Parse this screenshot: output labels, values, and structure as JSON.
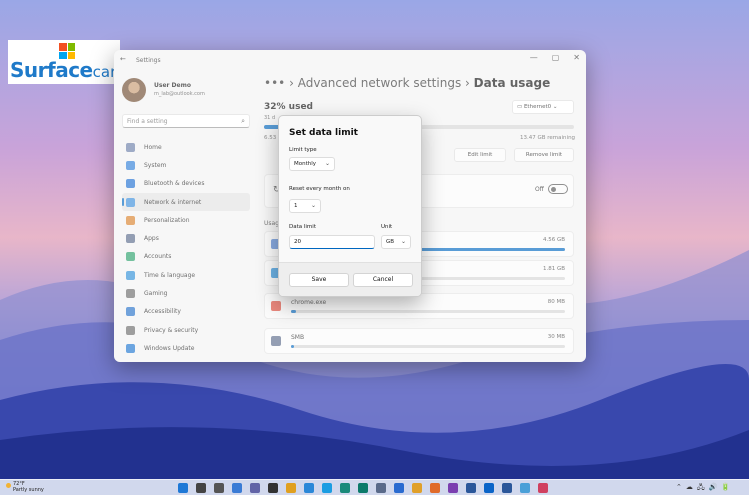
{
  "logo": {
    "brand": "Surface",
    "suffix": "care"
  },
  "window": {
    "title": "Settings",
    "back_glyph": "←",
    "controls": [
      "—",
      "▢",
      "✕"
    ]
  },
  "user": {
    "name": "User Demo",
    "email": "m_lab@outlook.com"
  },
  "sidebar": {
    "search_placeholder": "Find a setting",
    "items": [
      {
        "label": "Home",
        "icon": "home-icon",
        "color": "#6b7ea8"
      },
      {
        "label": "System",
        "icon": "system-icon",
        "color": "#2f7ed8"
      },
      {
        "label": "Bluetooth & devices",
        "icon": "bluetooth-icon",
        "color": "#1f6fd1"
      },
      {
        "label": "Network & internet",
        "icon": "network-icon",
        "color": "#3b8edb",
        "active": true
      },
      {
        "label": "Personalization",
        "icon": "brush-icon",
        "color": "#d9822b"
      },
      {
        "label": "Apps",
        "icon": "apps-icon",
        "color": "#5a6a8a"
      },
      {
        "label": "Accounts",
        "icon": "accounts-icon",
        "color": "#2aa06b"
      },
      {
        "label": "Time & language",
        "icon": "globe-icon",
        "color": "#2f8fd8"
      },
      {
        "label": "Gaming",
        "icon": "gaming-icon",
        "color": "#6b6b6b"
      },
      {
        "label": "Accessibility",
        "icon": "accessibility-icon",
        "color": "#2670c8"
      },
      {
        "label": "Privacy & security",
        "icon": "shield-icon",
        "color": "#6b6b6b"
      },
      {
        "label": "Windows Update",
        "icon": "update-icon",
        "color": "#1e76d0"
      }
    ]
  },
  "content": {
    "breadcrumb_more": "•••",
    "breadcrumb_parent": "Advanced network settings",
    "breadcrumb_sep": "›",
    "breadcrumb_current": "Data usage",
    "used_label": "32% used",
    "used_fraction": 0.32,
    "adapter": "Ethernet0",
    "small_top": "31 d",
    "small_left": "6.53",
    "remaining": "13.47 GB remaining",
    "edit_limit": "Edit limit",
    "remove_limit": "Remove limit",
    "throttle_sub": "ge",
    "toggle_state": "Off",
    "usage_label": "Usag",
    "apps": [
      {
        "name": "",
        "value": "4.56 GB",
        "fraction": 1.0,
        "icon_color": "#4a7fd1"
      },
      {
        "name": "",
        "value": "1.81 GB",
        "fraction": 0.4,
        "icon_color": "#1f8ad9"
      },
      {
        "name": "chrome.exe",
        "value": "80 MB",
        "fraction": 0.02,
        "icon_color": "#e04a3a"
      },
      {
        "name": "SMB",
        "value": "30 MB",
        "fraction": 0.01,
        "icon_color": "#5b6b8b"
      }
    ]
  },
  "dialog": {
    "title": "Set data limit",
    "limit_type_label": "Limit type",
    "limit_type_value": "Monthly",
    "reset_label": "Reset every month on",
    "reset_value": "1",
    "data_limit_label": "Data limit",
    "data_limit_value": "20",
    "unit_label": "Unit",
    "unit_value": "GB",
    "save": "Save",
    "cancel": "Cancel",
    "chevron": "⌄"
  },
  "taskbar": {
    "temperature": "72°F",
    "weather": "Partly sunny",
    "icons": [
      {
        "name": "windows-start-icon",
        "color": "#1e78d6"
      },
      {
        "name": "search-icon",
        "color": "#444444"
      },
      {
        "name": "task-view-icon",
        "color": "#555555"
      },
      {
        "name": "widgets-icon",
        "color": "#3a7bd5"
      },
      {
        "name": "teams-icon",
        "color": "#6264a7"
      },
      {
        "name": "terminal-icon",
        "color": "#333333"
      },
      {
        "name": "paint-icon",
        "color": "#e0a020"
      },
      {
        "name": "photos-icon",
        "color": "#2b88d8"
      },
      {
        "name": "edge-icon",
        "color": "#1b9de2"
      },
      {
        "name": "edge-beta-icon",
        "color": "#1a8a7a"
      },
      {
        "name": "edge-dev-icon",
        "color": "#0b7a6a"
      },
      {
        "name": "settings-icon",
        "color": "#5a6a8a"
      },
      {
        "name": "store-icon",
        "color": "#2a6bd0"
      },
      {
        "name": "chrome-icon",
        "color": "#e0a02a"
      },
      {
        "name": "firefox-icon",
        "color": "#e06b2a"
      },
      {
        "name": "onenote-icon",
        "color": "#7b3fb0"
      },
      {
        "name": "word-icon",
        "color": "#2b579a"
      },
      {
        "name": "outlook-icon",
        "color": "#0a64c8"
      },
      {
        "name": "word-2-icon",
        "color": "#2b579a"
      },
      {
        "name": "notepad-icon",
        "color": "#4aa0d8"
      },
      {
        "name": "snipping-icon",
        "color": "#d04060"
      }
    ],
    "tray": [
      "⌃",
      "☁",
      "🖧",
      "🔊",
      "🔋"
    ]
  }
}
